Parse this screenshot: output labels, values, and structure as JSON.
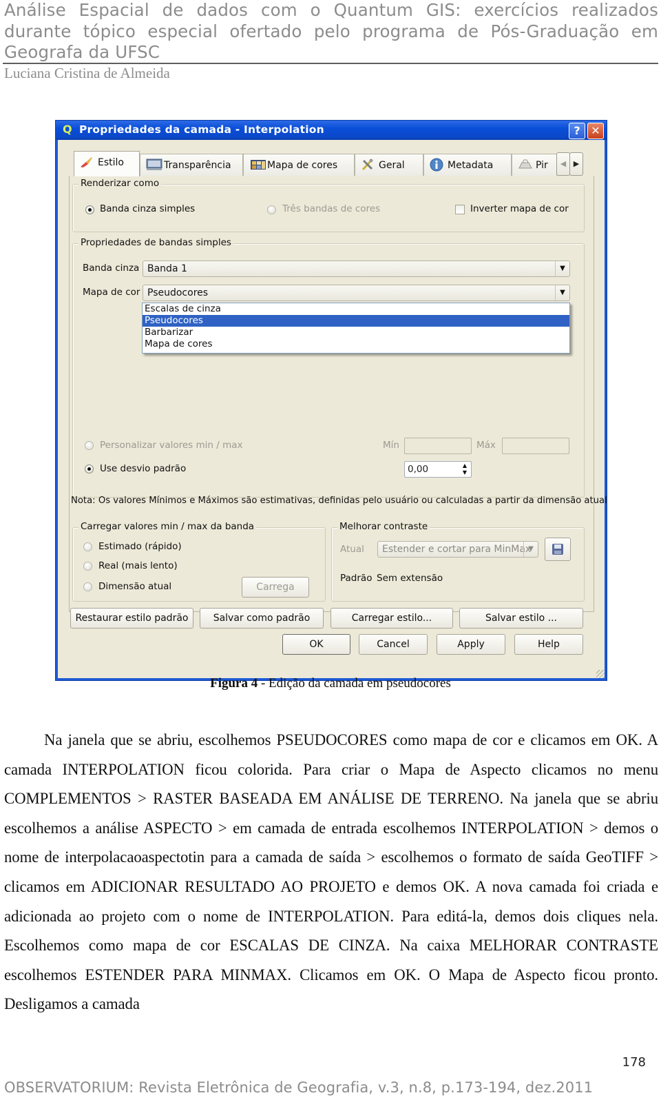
{
  "header": {
    "title": "Análise Espacial de dados com o Quantum GIS: exercícios realizados durante tópico especial ofertado pelo programa de Pós-Graduação em Geografa da UFSC",
    "author": "Luciana Cristina de Almeida"
  },
  "dialog": {
    "title": "Propriedades da camada - Interpolation",
    "help_button": "?",
    "close_button": "✕",
    "tabs": [
      {
        "label": "Estilo",
        "icon": "paintbrush-icon",
        "active": true
      },
      {
        "label": "Transparência",
        "icon": "transparency-icon",
        "active": false
      },
      {
        "label": "Mapa de cores",
        "icon": "colormap-icon",
        "active": false
      },
      {
        "label": "Geral",
        "icon": "tools-icon",
        "active": false
      },
      {
        "label": "Metadata",
        "icon": "info-icon",
        "active": false
      },
      {
        "label": "Pir",
        "icon": "pyramid-icon",
        "active": false
      }
    ],
    "tab_scroll_left": "◀",
    "tab_scroll_right": "▶",
    "render_group": {
      "label": "Renderizar como",
      "option_single": "Banda cinza simples",
      "option_three": "Três bandas de cores",
      "invert_label": "Inverter mapa de cor",
      "selected": "Banda cinza simples",
      "invert_checked": false
    },
    "single_band_group": {
      "label": "Propriedades de bandas simples",
      "gray_band_label": "Banda cinza",
      "gray_band_value": "Banda 1",
      "color_map_label": "Mapa de cor",
      "color_map_value": "Pseudocores",
      "color_map_options": [
        "Escalas de cinza",
        "Pseudocores",
        "Barbarizar",
        "Mapa de cores"
      ],
      "color_map_selected_index": 1,
      "custom_minmax_label": "Personalizar valores min / max",
      "min_label": "Mín",
      "max_label": "Máx",
      "min_value": "",
      "max_value": "",
      "use_stddev_label": "Use desvio padrão",
      "stddev_value": "0,00"
    },
    "note": "Nota: Os valores Mínimos e Máximos são estimativas, definidas pelo usuário ou calculadas a partir da dimensão atual",
    "load_minmax_group": {
      "label": "Carregar valores min / max da banda",
      "option_estimated": "Estimado (rápido)",
      "option_actual": "Real (mais lento)",
      "option_extent": "Dimensão atual",
      "load_button": "Carrega"
    },
    "contrast_group": {
      "label": "Melhorar contraste",
      "current_label": "Atual",
      "current_value": "Estender e cortar para MinMax",
      "default_label": "Padrão",
      "default_value": "Sem extensão"
    },
    "style_buttons": {
      "restore": "Restaurar estilo padrão",
      "save_default": "Salvar como padrão",
      "load_style": "Carregar estilo...",
      "save_style": "Salvar estilo ..."
    },
    "action_buttons": {
      "ok": "OK",
      "cancel": "Cancel",
      "apply": "Apply",
      "help": "Help"
    }
  },
  "caption": {
    "label": "Figura 4",
    "text": " - Edição da camada em pseudocores"
  },
  "body_paragraph": "Na janela que se abriu, escolhemos PSEUDOCORES como mapa de cor e clicamos em OK. A camada INTERPOLATION ficou colorida. Para criar o Mapa de Aspecto clicamos no menu COMPLEMENTOS > RASTER BASEADA EM ANÁLISE DE TERRENO. Na janela que se abriu escolhemos a análise ASPECTO > em camada de entrada escolhemos INTERPOLATION > demos o nome de interpolacaoaspectotin para a camada de saída > escolhemos o formato de saída GeoTIFF > clicamos em ADICIONAR RESULTADO AO PROJETO e demos OK. A nova camada foi criada e adicionada ao projeto com o nome de INTERPOLATION. Para editá-la, demos dois cliques nela. Escolhemos como mapa de cor ESCALAS DE CINZA. Na caixa MELHORAR CONTRASTE escolhemos ESTENDER PARA MINMAX. Clicamos em OK. O Mapa de Aspecto ficou pronto. Desligamos a camada",
  "page_number": "178",
  "footer": "OBSERVATORIUM: Revista Eletrônica de Geografia, v.3, n.8, p.173-194, dez.2011",
  "colors": {
    "titlebar": "#0a4fd8",
    "dialog_bg": "#ece9d8",
    "selection": "#2f62c4",
    "header_gray": "#8c8c8c"
  }
}
